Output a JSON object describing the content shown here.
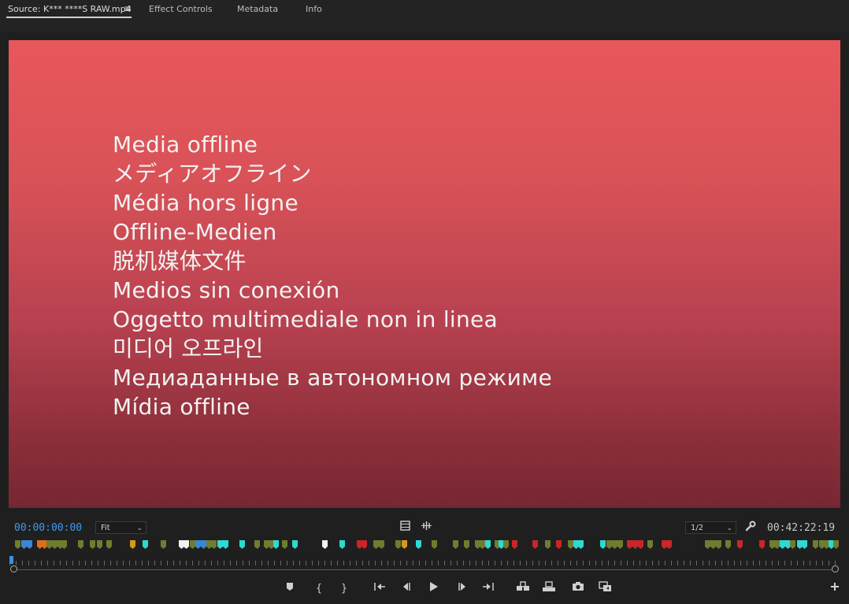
{
  "tabs": [
    {
      "label": "Source: K*** ****S RAW.mp4",
      "active": true
    },
    {
      "label": "Effect Controls",
      "active": false
    },
    {
      "label": "Metadata",
      "active": false
    },
    {
      "label": "Info",
      "active": false
    }
  ],
  "tab_menu_icon": "hamburger-menu-icon",
  "viewer": {
    "lines": [
      "Media offline",
      "メディアオフライン",
      "Média hors ligne",
      "Offline-Medien",
      "脱机媒体文件",
      "Medios sin conexión",
      "Oggetto multimediale non in linea",
      "미디어 오프라인",
      "Медиаданные в автономном режиме",
      "Mídia offline"
    ],
    "gradient_top": "#e8575b",
    "gradient_bottom": "#762733"
  },
  "controls": {
    "timecode_current": "00:00:00:00",
    "zoom_value": "Fit",
    "resolution_value": "1/2",
    "timecode_duration": "00:42:22:19"
  },
  "marker_colors": {
    "green": "#6e7d2f",
    "blue": "#3a86d6",
    "orange": "#e06d1a",
    "yellow": "#d39a1e",
    "white": "#f2f2f2",
    "cyan": "#2fd9d1",
    "red": "#c9262b"
  },
  "transport_icons": [
    "add-marker-icon",
    "mark-in-icon",
    "mark-out-icon",
    "go-to-in-icon",
    "step-back-icon",
    "play-icon",
    "step-forward-icon",
    "go-to-out-icon",
    "insert-icon",
    "overwrite-icon",
    "export-frame-icon",
    "multicam-icon",
    "add-button-icon"
  ]
}
